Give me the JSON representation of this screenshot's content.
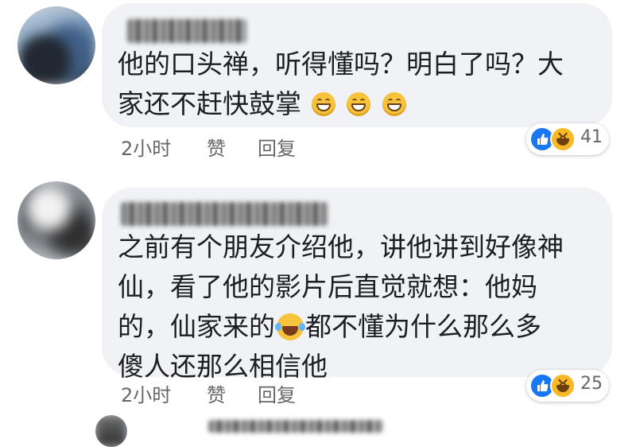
{
  "comments": [
    {
      "text_line1": "他的口头禅，听得懂吗？明白了吗？大",
      "text_line2": "家还不赶快鼓掌",
      "time": "2小时",
      "like": "赞",
      "reply": "回复",
      "reaction_count": "41"
    },
    {
      "text_line1": "之前有个朋友介绍他，讲他讲到好像神",
      "text_line2": "仙，看了他的影片后直觉就想：他妈",
      "text_line3a": "的，仙家来的",
      "text_line3b": "都不懂为什么那么多",
      "text_line4": "傻人还那么相信他",
      "time": "2小时",
      "like": "赞",
      "reply": "回复",
      "reaction_count": "25"
    }
  ],
  "icons": {
    "reaction_like": "thumbs-up-icon",
    "reaction_haha": "laughing-face-icon",
    "inline_emoji_1": "grinning-face-icon",
    "inline_emoji_2": "face-with-tears-of-joy-icon"
  },
  "colors": {
    "bubble": "#f0f2f5",
    "text": "#1c1e21",
    "meta": "#65676b",
    "like_blue": "#1877f2",
    "haha_yellow": "#f7b928"
  }
}
